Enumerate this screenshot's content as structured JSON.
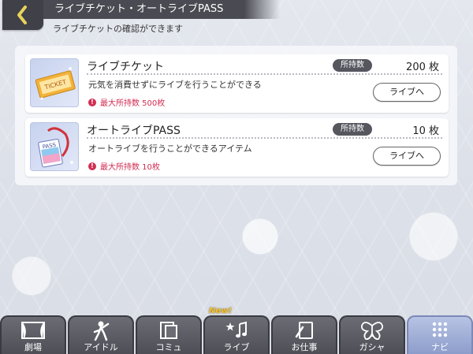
{
  "header": {
    "title": "ライブチケット・オートライブPASS",
    "subtitle": "ライブチケットの確認ができます"
  },
  "items": [
    {
      "name": "ライブチケット",
      "owned_label": "所持数",
      "owned_count": "200 枚",
      "description": "元気を消費せずにライブを行うことができる",
      "max_label": "最大所持数 500枚",
      "button_label": "ライブへ",
      "icon": "ticket-icon",
      "icon_text": "TICKET"
    },
    {
      "name": "オートライブPASS",
      "owned_label": "所持数",
      "owned_count": "10 枚",
      "description": "オートライブを行うことができるアイテム",
      "max_label": "最大所持数 10枚",
      "button_label": "ライブへ",
      "icon": "pass-icon",
      "icon_text": "PASS"
    }
  ],
  "nav": {
    "new_badge": "New!",
    "tabs": [
      {
        "label": "劇場",
        "icon": "theater-icon"
      },
      {
        "label": "アイドル",
        "icon": "idol-icon"
      },
      {
        "label": "コミュ",
        "icon": "commu-icon"
      },
      {
        "label": "ライブ",
        "icon": "live-icon"
      },
      {
        "label": "お仕事",
        "icon": "work-icon"
      },
      {
        "label": "ガシャ",
        "icon": "gacha-icon"
      },
      {
        "label": "ナビ",
        "icon": "navi-icon",
        "active": true
      }
    ]
  },
  "colors": {
    "accent_red": "#d22d52",
    "header_dark": "#4a4b52",
    "nav_active": "#8d9dcb"
  }
}
